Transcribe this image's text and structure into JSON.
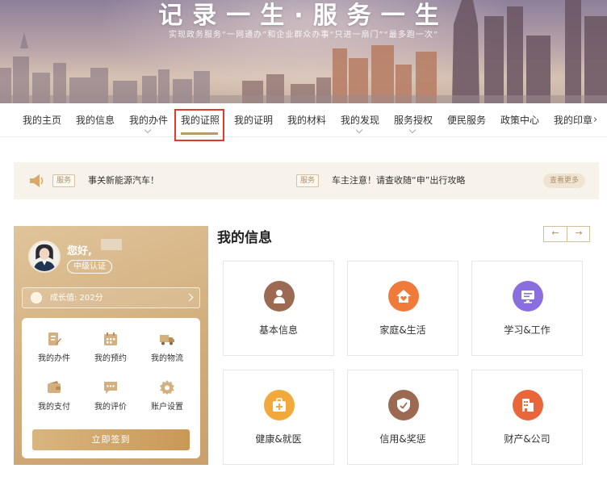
{
  "banner": {
    "title": "记录一生·服务一生",
    "subtitle": "实现政务服务“一网通办”和企业群众办事“只进一扇门”“最多跑一次”"
  },
  "nav": {
    "items": [
      "我的主页",
      "我的信息",
      "我的办件",
      "我的证照",
      "我的证明",
      "我的材料",
      "我的发现",
      "服务授权",
      "便民服务",
      "政策中心",
      "我的印章"
    ],
    "active_index": 3,
    "next_arrow": "›"
  },
  "notice": {
    "tag": "服务",
    "items": [
      "事关新能源汽车！",
      "车主注意！请查收随“申”出行攻略"
    ],
    "more_label": "查看更多"
  },
  "profile": {
    "greeting": "您好,",
    "level": "中级认证",
    "growth": "成长值: 202分",
    "actions": [
      "我的办件",
      "我的预约",
      "我的物流",
      "我的支付",
      "我的评价",
      "账户设置"
    ],
    "signin_label": "立即签到"
  },
  "info": {
    "title": "我的信息",
    "prev": "←",
    "next": "→",
    "cards": [
      "基本信息",
      "家庭&生活",
      "学习&工作",
      "健康&就医",
      "信用&奖惩",
      "财产&公司"
    ]
  },
  "colors": {
    "accent_gold": "#c9a06c",
    "highlight_red": "#e23b2e",
    "icon_brown": "#9c6a52",
    "icon_orange": "#f07a3a",
    "icon_purple": "#8a6ee0",
    "icon_amber": "#f2a93b",
    "icon_redorange": "#e8663a"
  }
}
